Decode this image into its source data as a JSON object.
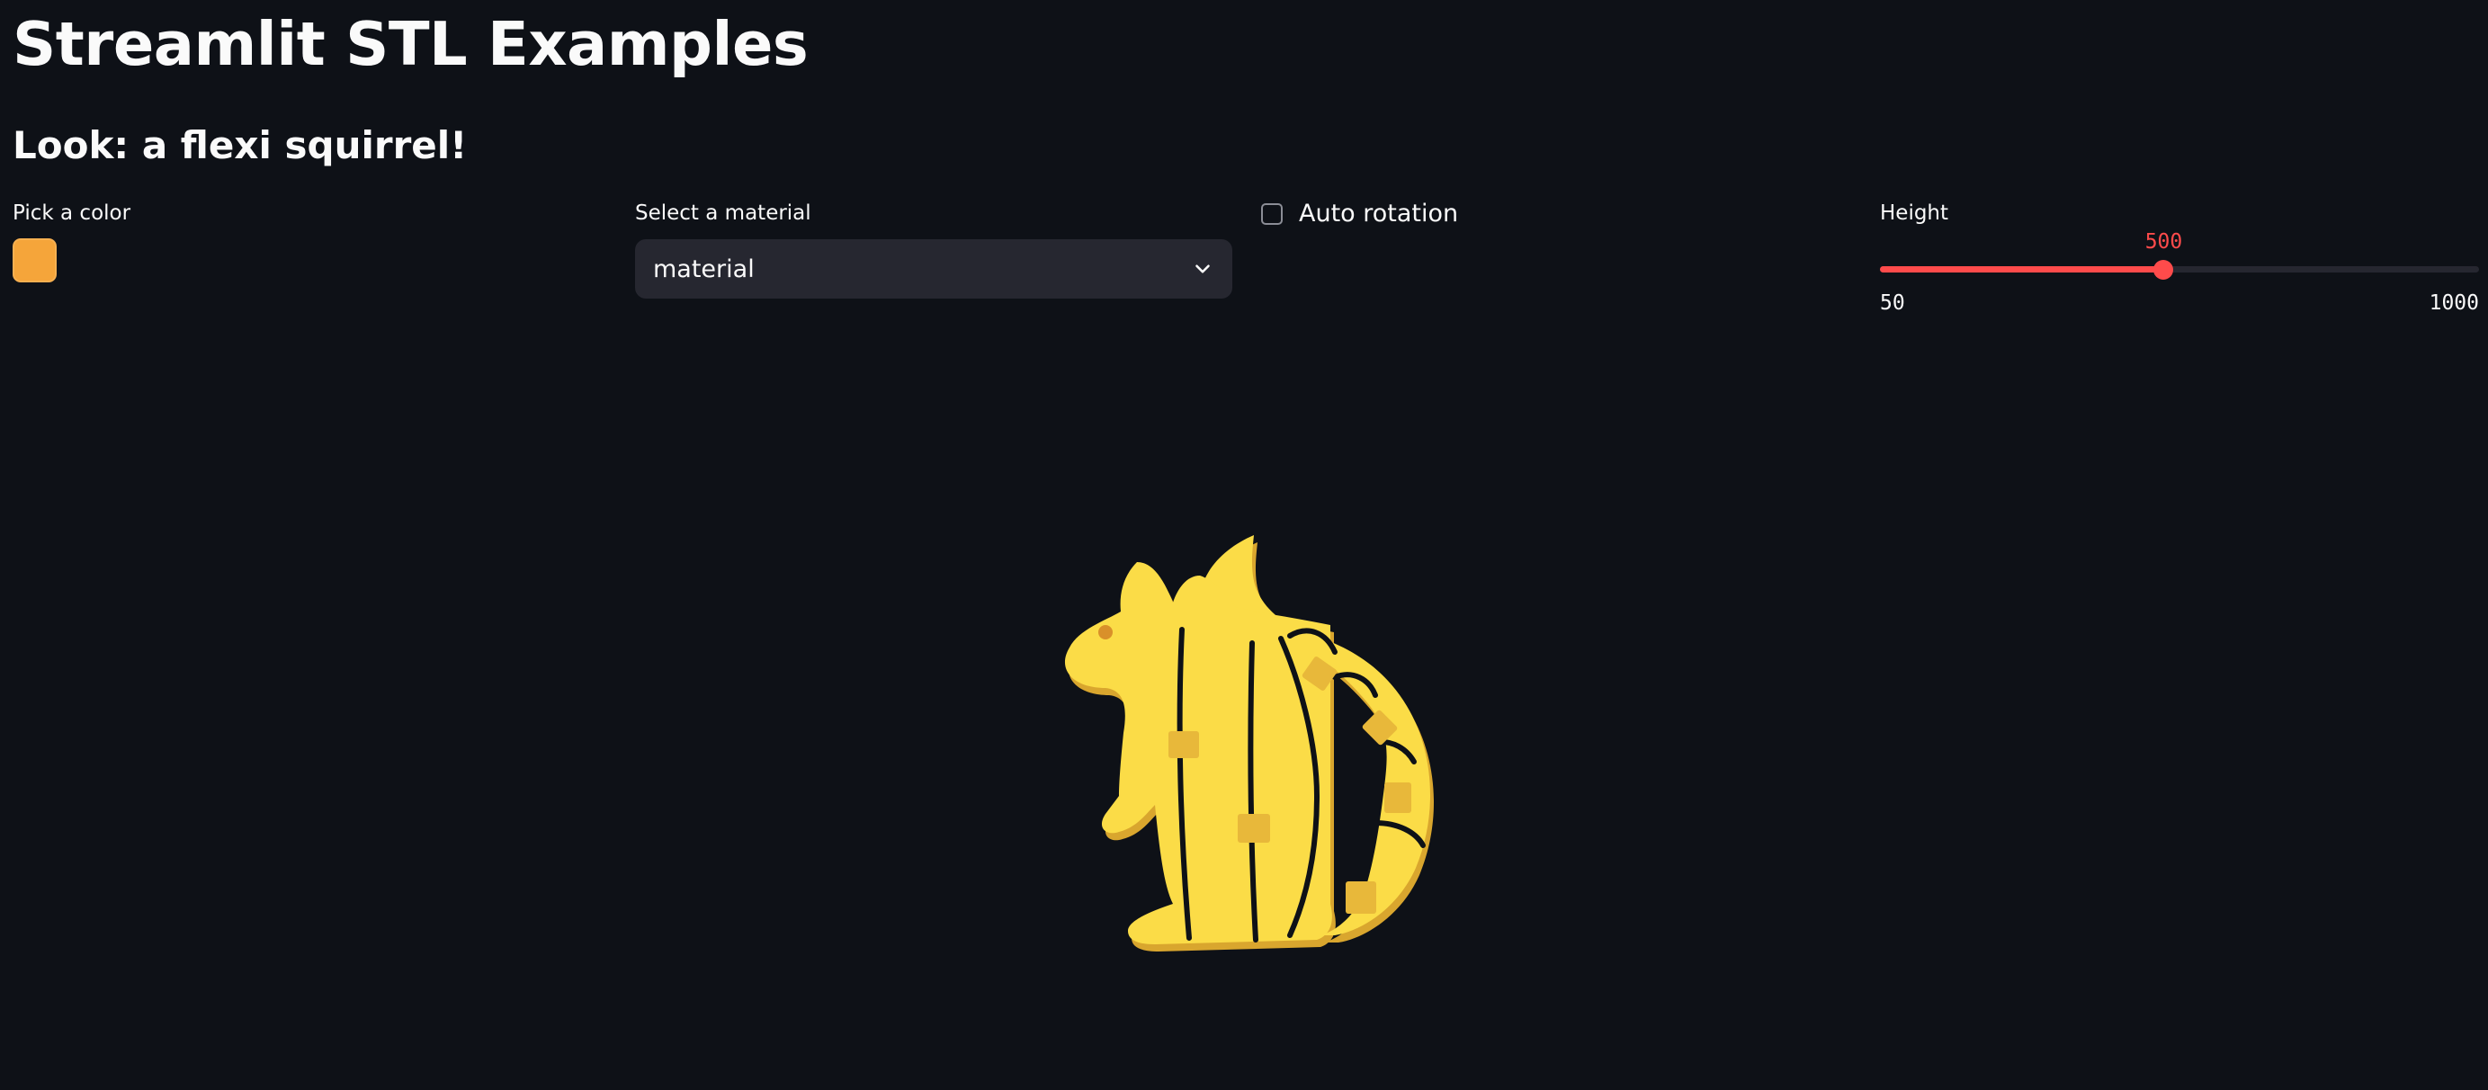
{
  "header": {
    "title": "Streamlit STL Examples",
    "subtitle": "Look: a flexi squirrel!"
  },
  "color_picker": {
    "label": "Pick a color",
    "value": "#f5a53a"
  },
  "material_select": {
    "label": "Select a material",
    "value": "material",
    "icon": "chevron-down-icon"
  },
  "auto_rotation": {
    "label": "Auto rotation",
    "checked": false
  },
  "height_slider": {
    "label": "Height",
    "value": "500",
    "min": "50",
    "max": "1000",
    "fraction": 0.4737
  },
  "viewer": {
    "model_name": "flexi squirrel",
    "model_color": "#fbdc47",
    "model_shadow_color": "#d9a62e"
  },
  "colors": {
    "background": "#0e1117",
    "accent": "#ff4b4b",
    "widget_bg": "#262730",
    "text": "#fafafa"
  }
}
